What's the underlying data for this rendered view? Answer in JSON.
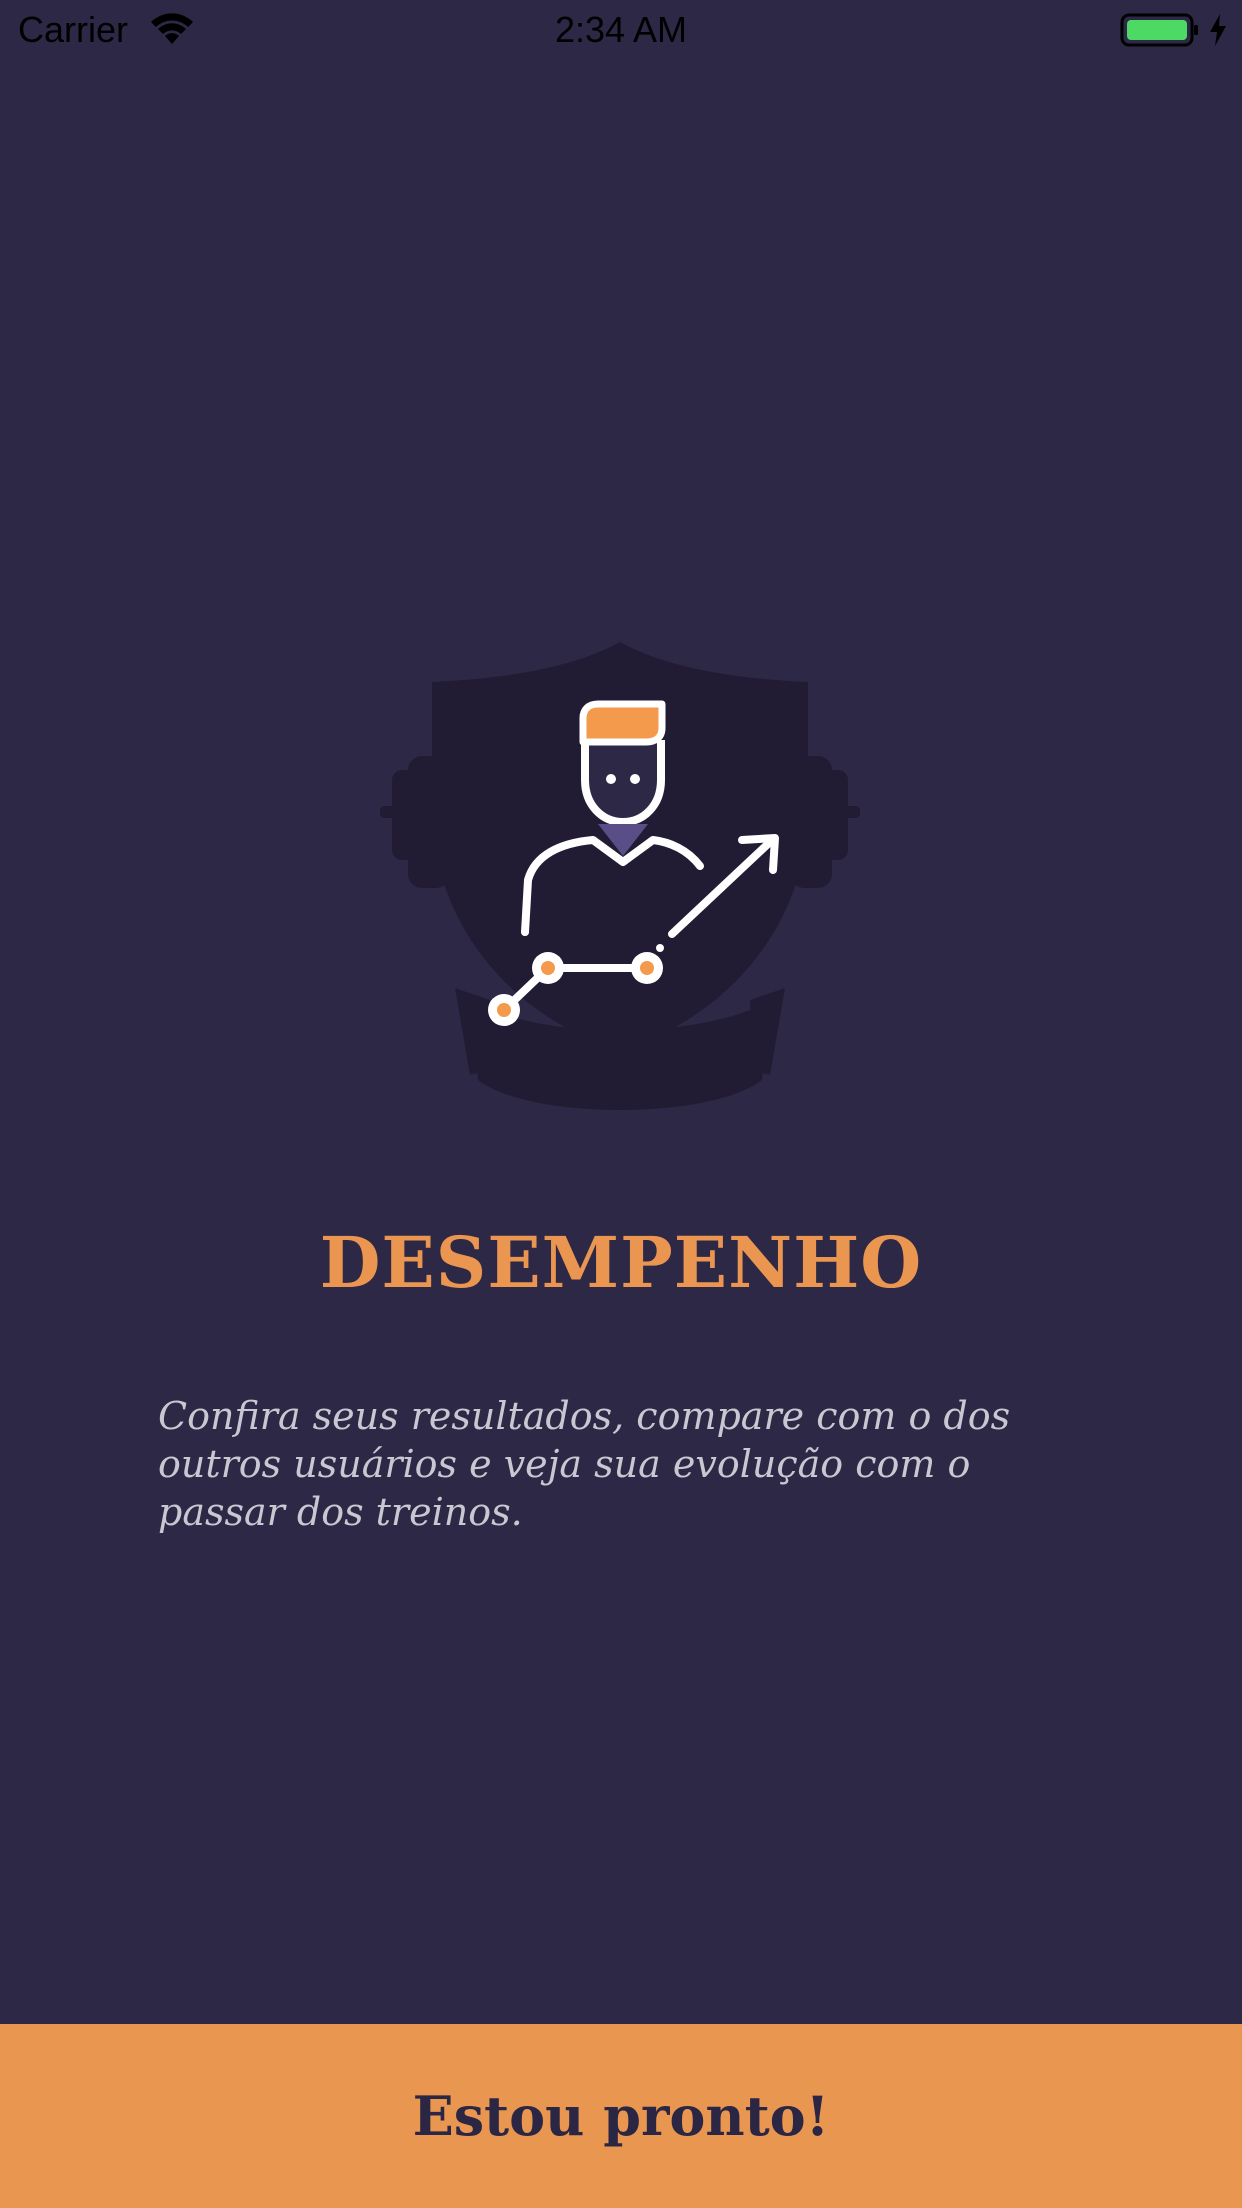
{
  "status_bar": {
    "carrier": "Carrier",
    "time": "2:34 AM",
    "battery_color": "#4cd964"
  },
  "onboarding": {
    "hero_icon": "performance-chart-icon",
    "title": "DESEMPENHO",
    "description": "Confira seus resultados, compare com o dos outros usuários e veja sua evolução com o passar dos treinos."
  },
  "cta": {
    "label": "Estou pronto!"
  },
  "colors": {
    "background": "#2d2845",
    "accent": "#e99651",
    "emblem": "#211c33",
    "text_muted": "#c9c7d1"
  }
}
